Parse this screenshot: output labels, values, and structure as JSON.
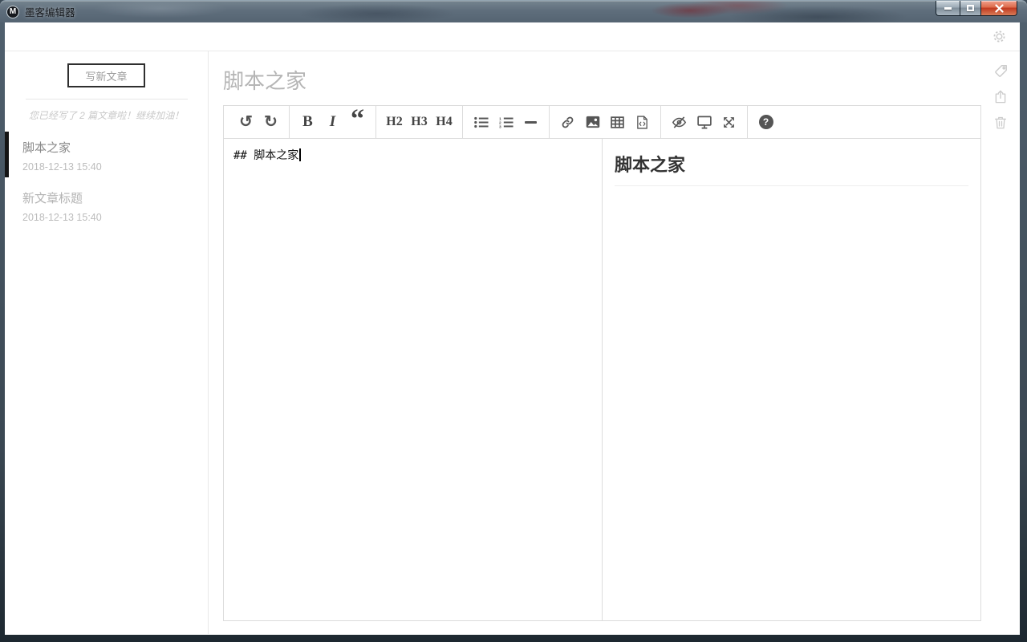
{
  "window": {
    "logo_letter": "M",
    "title": "墨客编辑器"
  },
  "topbar": {
    "settings_icon": "gear"
  },
  "sidebar": {
    "new_article_button": "写新文章",
    "hint": "您已经写了 2 篇文章啦！继续加油！",
    "articles": [
      {
        "title": "脚本之家",
        "date": "2018-12-13 15:40",
        "active": true
      },
      {
        "title": "新文章标题",
        "date": "2018-12-13 15:40",
        "active": false
      }
    ]
  },
  "main": {
    "title_value": "脚本之家",
    "editor_content": "## 脚本之家",
    "preview_heading": "脚本之家"
  },
  "toolbar": {
    "undo": "↺",
    "redo": "↻",
    "bold": "B",
    "italic": "I",
    "quote": "“",
    "h2": "H2",
    "h3": "H3",
    "h4": "H4",
    "help": "?"
  },
  "colors": {
    "titlebar_glass": "#5f6e7c",
    "close_button": "#c0391f",
    "toolbar_icon": "#555555",
    "rail_icon": "#c9c9c9",
    "muted_text": "#b3b3b3",
    "active_indicator": "#141414",
    "divider": "#e9e9e9"
  }
}
